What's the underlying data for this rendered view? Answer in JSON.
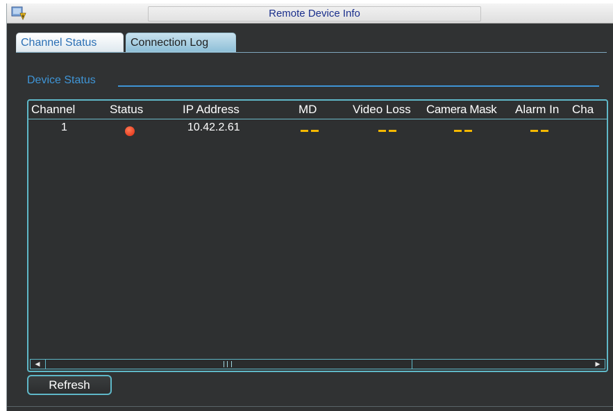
{
  "window": {
    "title": "Remote Device Info",
    "icon": "app-info-icon"
  },
  "tabs": [
    {
      "label": "Channel Status",
      "active": true
    },
    {
      "label": "Connection Log",
      "active": false
    }
  ],
  "section": {
    "label": "Device Status"
  },
  "table": {
    "columns": [
      "Channel",
      "Status",
      "IP Address",
      "MD",
      "Video Loss",
      "Camera Mask",
      "Alarm In",
      "Cha"
    ],
    "rows": [
      {
        "channel": "1",
        "status_icon": "red-status-dot",
        "ip_address": "10.42.2.61",
        "md": "--",
        "video_loss": "--",
        "camera_mask": "--",
        "alarm_in": "--"
      }
    ]
  },
  "scrollbar": {
    "left_arrow": "◀",
    "right_arrow": "▶"
  },
  "buttons": {
    "refresh": "Refresh"
  },
  "colors": {
    "accent": "#3f95d6",
    "border": "#5fb8c8",
    "status_offline": "#e02a10",
    "placeholder_dash": "#f5b800",
    "title_text": "#1a2f8c"
  }
}
